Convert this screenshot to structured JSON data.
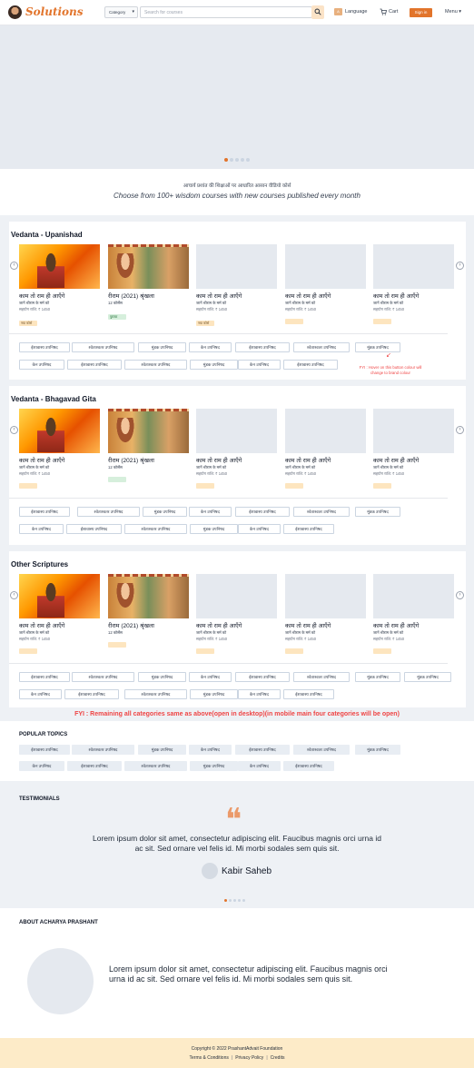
{
  "header": {
    "brand": "Solutions",
    "category_label": "Category",
    "search_placeholder": "Search for courses",
    "language_label": "Language",
    "cart_label": "Cart",
    "signin_label": "Sign in",
    "menu_label": "Menu",
    "accent_color": "#e2742b"
  },
  "intro": {
    "hindi_line": "आचार्य प्रशांत की शिक्षाओं पर आधारित आसान वीडियो कोर्स",
    "english_line": "Choose from 100+ wisdom courses with new courses published every month"
  },
  "sections": [
    {
      "title": "Vedanta - Upanishad",
      "cards": [
        {
          "image": "ram",
          "title": "काम तो राम ही आएँगे",
          "sub": "जानें श्रीराम के मर्म को",
          "price": "सहयोग राशि: ₹ 1450",
          "badge": "नया कोर्स",
          "badge_style": "orange"
        },
        {
          "image": "ramseries",
          "title": "रीराम (2021) श्रृंखला",
          "sub": "12 कोर्सेस",
          "price": "",
          "badge": "पुस्तक",
          "badge_style": "green"
        },
        {
          "image": "blank",
          "title": "काम तो राम ही आएँगे",
          "sub": "जानें श्रीराम के मर्म को",
          "price": "सहयोग राशि: ₹ 1450",
          "badge": "नया कोर्स",
          "badge_style": "orange"
        },
        {
          "image": "blank",
          "title": "काम तो राम ही आएँगे",
          "sub": "जानें श्रीराम के मर्म को",
          "price": "सहयोग राशि: ₹ 1450",
          "badge": "",
          "badge_style": "orange"
        },
        {
          "image": "blank",
          "title": "काम तो राम ही आएँगे",
          "sub": "जानें श्रीराम के मर्म को",
          "price": "सहयोग राशि: ₹ 1450",
          "badge": "",
          "badge_style": "orange"
        }
      ],
      "pills": [
        "ईशावास्य उपनिषद",
        "श्वेताश्वतर उपनिषद",
        "मुंडक उपनिषद",
        "केन उपनिषद",
        "ईशावास्य उपनिषद",
        "श्वेताश्वतर उपनिषद",
        "मुंडक उपनिषद",
        "केन उपनिषद",
        "ईशावास्य उपनिषद",
        "श्वेताश्वतर उपनिषद",
        "मुंडक उपनिषद",
        "केन उपनिषद",
        "ईशावास्य उपनिषद"
      ],
      "note": "FYI : Hover on this button colour will change to brand colour"
    },
    {
      "title": "Vedanta - Bhagavad Gita",
      "cards": [
        {
          "image": "ram",
          "title": "काम तो राम ही आएँगे",
          "sub": "जानें श्रीराम के मर्म को",
          "price": "सहयोग राशि: ₹ 1450",
          "badge": "",
          "badge_style": "orange"
        },
        {
          "image": "ramseries",
          "title": "रीराम (2021) श्रृंखला",
          "sub": "12 कोर्सेस",
          "price": "",
          "badge": "",
          "badge_style": "green"
        },
        {
          "image": "blank",
          "title": "काम तो राम ही आएँगे",
          "sub": "जानें श्रीराम के मर्म को",
          "price": "सहयोग राशि: ₹ 1450",
          "badge": "",
          "badge_style": "orange"
        },
        {
          "image": "blank",
          "title": "काम तो राम ही आएँगे",
          "sub": "जानें श्रीराम के मर्म को",
          "price": "सहयोग राशि: ₹ 1450",
          "badge": "",
          "badge_style": "orange"
        },
        {
          "image": "blank",
          "title": "काम तो राम ही आएँगे",
          "sub": "जानें श्रीराम के मर्म को",
          "price": "सहयोग राशि: ₹ 1450",
          "badge": "",
          "badge_style": "orange"
        }
      ],
      "pills": [
        "ईशावास्य उपनिषद",
        "श्वेताश्वतर उपनिषद",
        "मुंडक उपनिषद",
        "केन उपनिषद",
        "ईशावास्य उपनिषद",
        "श्वेताश्वतर उपनिषद",
        "मुंडक उपनिषद",
        "केन उपनिषद",
        "ईशावास्य उपनिषद",
        "श्वेताश्वतर उपनिषद",
        "मुंडक उपनिषद",
        "केन उपनिषद",
        "ईशावास्य उपनिषद"
      ]
    },
    {
      "title": "Other Scriptures",
      "cards": [
        {
          "image": "ram",
          "title": "काम तो राम ही आएँगे",
          "sub": "जानें श्रीराम के मर्म को",
          "price": "सहयोग राशि: ₹ 1450",
          "badge": "",
          "badge_style": "orange"
        },
        {
          "image": "ramseries",
          "title": "रीराम (2021) श्रृंखला",
          "sub": "12 कोर्सेस",
          "price": "",
          "badge": "",
          "badge_style": "orange"
        },
        {
          "image": "blank",
          "title": "काम तो राम ही आएँगे",
          "sub": "जानें श्रीराम के मर्म को",
          "price": "सहयोग राशि: ₹ 1450",
          "badge": "",
          "badge_style": "orange"
        },
        {
          "image": "blank",
          "title": "काम तो राम ही आएँगे",
          "sub": "जानें श्रीराम के मर्म को",
          "price": "सहयोग राशि: ₹ 1450",
          "badge": "",
          "badge_style": "orange"
        },
        {
          "image": "blank",
          "title": "काम तो राम ही आएँगे",
          "sub": "जानें श्रीराम के मर्म को",
          "price": "सहयोग राशि: ₹ 1450",
          "badge": "",
          "badge_style": "orange"
        }
      ],
      "pills": [
        "ईशावास्य उपनिषद",
        "श्वेताश्वतर उपनिषद",
        "मुंडक उपनिषद",
        "केन उपनिषद",
        "ईशावास्य उपनिषद",
        "श्वेताश्वतर उपनिषद",
        "मुंडक उपनिषद",
        "मुंडक उपनिषद",
        "केन उपनिषद",
        "ईशावास्य उपनिषद",
        "श्वेताश्वतर उपनिषद",
        "मुंडक उपनिषद",
        "केन उपनिषद",
        "ईशावास्य उपनिषद"
      ]
    }
  ],
  "fyi_main": "FYI : Remaining all categories same as above(open in desktop)(in mobile main four categories will be open)",
  "popular": {
    "title": "POPULAR TOPICS",
    "tags": [
      "ईशावास्य उपनिषद",
      "श्वेताश्वतर उपनिषद",
      "मुंडक उपनिषद",
      "केन उपनिषद",
      "ईशावास्य उपनिषद",
      "श्वेताश्वतर उपनिषद",
      "मुंडक उपनिषद",
      "केन उपनिषद",
      "ईशावास्य उपनिषद",
      "श्वेताश्वतर उपनिषद",
      "मुंडक उपनिषद",
      "केन उपनिषद",
      "ईशावास्य उपनिषद"
    ]
  },
  "testimonials": {
    "title": "TESTIMONIALS",
    "quote_mark": "❝",
    "text": "Lorem ipsum dolor sit amet, consectetur adipiscing elit. Faucibus magnis orci urna id ac sit. Sed ornare vel felis id. Mi morbi sodales sem quis sit.",
    "name": "Kabir Saheb"
  },
  "about": {
    "title": "ABOUT ACHARYA PRASHANT",
    "text": "Lorem ipsum dolor sit amet, consectetur adipiscing elit. Faucibus magnis orci urna id ac sit. Sed ornare vel felis id. Mi morbi sodales sem quis sit."
  },
  "footer": {
    "copyright": "Copyright © 2022 PrashantAdvait Foundation",
    "links": [
      "Terms & Conditions",
      "Privacy Policy",
      "Credits"
    ]
  }
}
